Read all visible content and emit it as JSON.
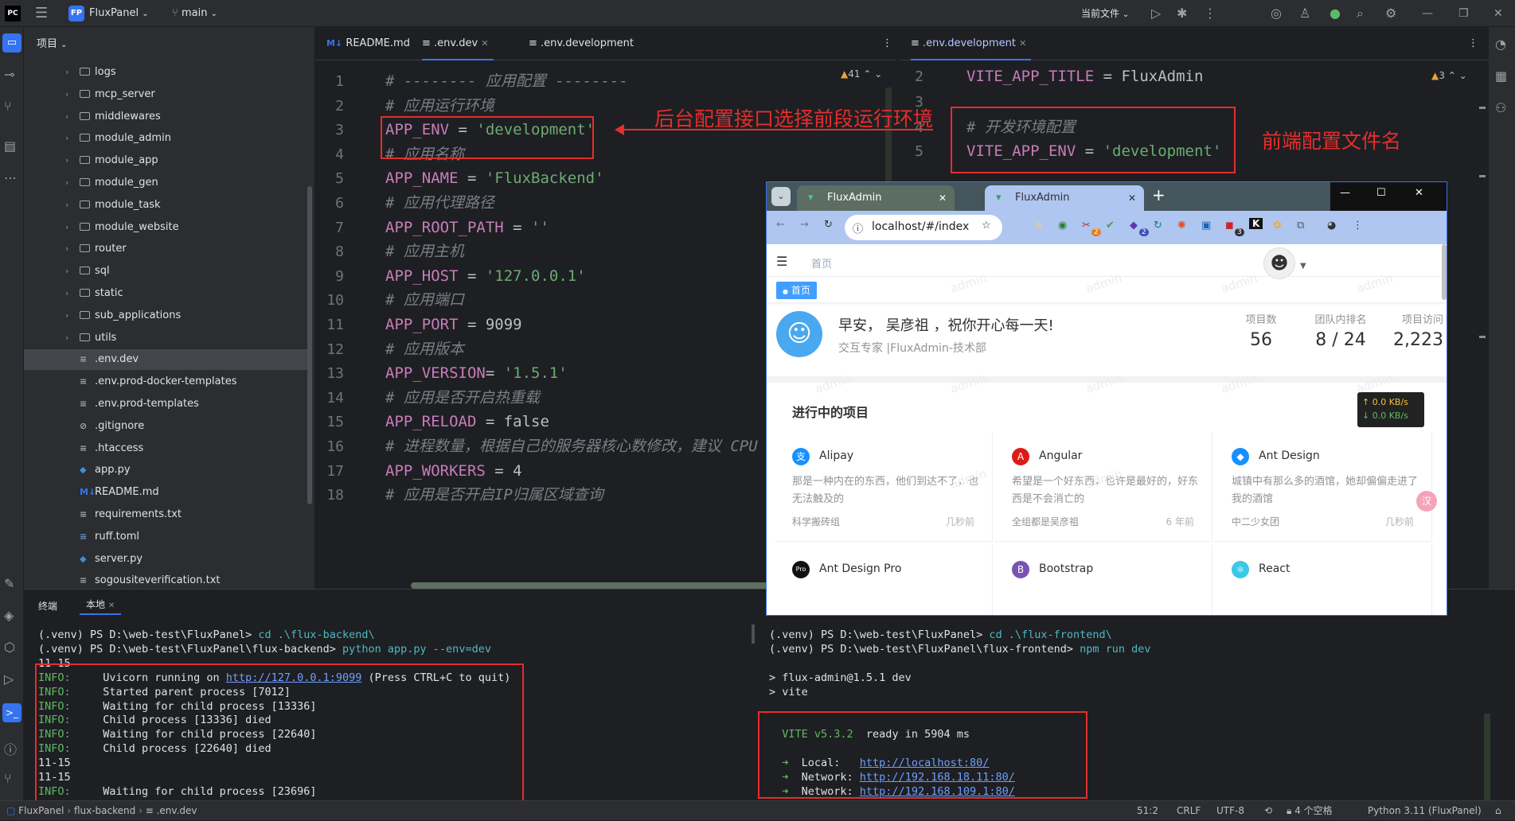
{
  "titlebar": {
    "project_badge": "FP",
    "project_name": "FluxPanel",
    "branch": "main",
    "run_config": "当前文件"
  },
  "project_panel": {
    "header": "项目",
    "items": [
      {
        "label": "logs",
        "type": "folder"
      },
      {
        "label": "mcp_server",
        "type": "folder"
      },
      {
        "label": "middlewares",
        "type": "folder"
      },
      {
        "label": "module_admin",
        "type": "folder"
      },
      {
        "label": "module_app",
        "type": "folder"
      },
      {
        "label": "module_gen",
        "type": "folder"
      },
      {
        "label": "module_task",
        "type": "folder"
      },
      {
        "label": "module_website",
        "type": "folder"
      },
      {
        "label": "router",
        "type": "folder"
      },
      {
        "label": "sql",
        "type": "folder"
      },
      {
        "label": "static",
        "type": "folder"
      },
      {
        "label": "sub_applications",
        "type": "folder"
      },
      {
        "label": "utils",
        "type": "folder"
      },
      {
        "label": ".env.dev",
        "type": "file"
      },
      {
        "label": ".env.prod-docker-templates",
        "type": "file"
      },
      {
        "label": ".env.prod-templates",
        "type": "file"
      },
      {
        "label": ".gitignore",
        "type": "file"
      },
      {
        "label": ".htaccess",
        "type": "file"
      },
      {
        "label": "app.py",
        "type": "file"
      },
      {
        "label": "README.md",
        "type": "file"
      },
      {
        "label": "requirements.txt",
        "type": "file"
      },
      {
        "label": "ruff.toml",
        "type": "file"
      },
      {
        "label": "server.py",
        "type": "file"
      },
      {
        "label": "sogousiteverification.txt",
        "type": "file"
      }
    ]
  },
  "editor_left": {
    "tabs": [
      "README.md",
      ".env.dev",
      ".env.development"
    ],
    "inspection_count": "41",
    "lines": [
      {
        "n": "1",
        "parts": [
          {
            "c": "cm",
            "t": "# -------- 应用配置 --------"
          }
        ]
      },
      {
        "n": "2",
        "parts": [
          {
            "c": "cm",
            "t": "# 应用运行环境"
          }
        ]
      },
      {
        "n": "3",
        "parts": [
          {
            "c": "ky",
            "t": "APP_ENV"
          },
          {
            "c": "val",
            "t": " = "
          },
          {
            "c": "st",
            "t": "'development'"
          }
        ]
      },
      {
        "n": "4",
        "parts": [
          {
            "c": "cm",
            "t": "# 应用名称"
          }
        ]
      },
      {
        "n": "5",
        "parts": [
          {
            "c": "ky",
            "t": "APP_NAME"
          },
          {
            "c": "val",
            "t": " = "
          },
          {
            "c": "st",
            "t": "'FluxBackend'"
          }
        ]
      },
      {
        "n": "6",
        "parts": [
          {
            "c": "cm",
            "t": "# 应用代理路径"
          }
        ]
      },
      {
        "n": "7",
        "parts": [
          {
            "c": "ky",
            "t": "APP_ROOT_PATH"
          },
          {
            "c": "val",
            "t": " = "
          },
          {
            "c": "st",
            "t": "''"
          }
        ]
      },
      {
        "n": "8",
        "parts": [
          {
            "c": "cm",
            "t": "# 应用主机"
          }
        ]
      },
      {
        "n": "9",
        "parts": [
          {
            "c": "ky",
            "t": "APP_HOST"
          },
          {
            "c": "val",
            "t": " = "
          },
          {
            "c": "st",
            "t": "'127.0.0.1'"
          }
        ]
      },
      {
        "n": "10",
        "parts": [
          {
            "c": "cm",
            "t": "# 应用端口"
          }
        ]
      },
      {
        "n": "11",
        "parts": [
          {
            "c": "ky",
            "t": "APP_PORT"
          },
          {
            "c": "val",
            "t": " = "
          },
          {
            "c": "val",
            "t": "9099"
          }
        ]
      },
      {
        "n": "12",
        "parts": [
          {
            "c": "cm",
            "t": "# 应用版本"
          }
        ]
      },
      {
        "n": "13",
        "parts": [
          {
            "c": "ky",
            "t": "APP_VERSION"
          },
          {
            "c": "val",
            "t": "= "
          },
          {
            "c": "st",
            "t": "'1.5.1'"
          }
        ]
      },
      {
        "n": "14",
        "parts": [
          {
            "c": "cm",
            "t": "# 应用是否开启热重载"
          }
        ]
      },
      {
        "n": "15",
        "parts": [
          {
            "c": "ky",
            "t": "APP_RELOAD"
          },
          {
            "c": "val",
            "t": " = "
          },
          {
            "c": "val",
            "t": "false"
          }
        ]
      },
      {
        "n": "16",
        "parts": [
          {
            "c": "cm",
            "t": "# 进程数量，根据自己的服务器核心数修改，建议 CPU"
          }
        ]
      },
      {
        "n": "17",
        "parts": [
          {
            "c": "ky",
            "t": "APP_WORKERS"
          },
          {
            "c": "val",
            "t": " = "
          },
          {
            "c": "val",
            "t": "4"
          }
        ]
      },
      {
        "n": "18",
        "parts": [
          {
            "c": "cm",
            "t": "# 应用是否开启IP归属区域查询"
          }
        ]
      }
    ]
  },
  "editor_right": {
    "tab": ".env.development",
    "inspection_count": "3",
    "lines": [
      {
        "n": "2",
        "parts": [
          {
            "c": "ky",
            "t": "VITE_APP_TITLE"
          },
          {
            "c": "val",
            "t": " = "
          },
          {
            "c": "val",
            "t": "FluxAdmin"
          }
        ]
      },
      {
        "n": "3",
        "parts": []
      },
      {
        "n": "4",
        "parts": [
          {
            "c": "cm",
            "t": "# 开发环境配置"
          }
        ]
      },
      {
        "n": "5",
        "parts": [
          {
            "c": "ky",
            "t": "VITE_APP_ENV"
          },
          {
            "c": "val",
            "t": " = "
          },
          {
            "c": "st",
            "t": "'development'"
          }
        ]
      }
    ]
  },
  "annotations": {
    "backend": "后台配置接口选择前段运行环境",
    "frontend": "前端配置文件名"
  },
  "browser": {
    "tabs": [
      "FluxAdmin",
      "FluxAdmin"
    ],
    "url": "localhost/#/index",
    "ext_badges": [
      "2",
      "2",
      "3"
    ],
    "breadcrumb": "首页",
    "tag": "首页",
    "greeting": "早安， 吴彦祖 ，祝你开心每一天!",
    "subtitle": "交互专家 |FluxAdmin-技术部",
    "stats": [
      {
        "label": "项目数",
        "value": "56"
      },
      {
        "label": "团队内排名",
        "value": "8 / 24"
      },
      {
        "label": "项目访问",
        "value": "2,223"
      }
    ],
    "section_title": "进行中的项目",
    "net_speed_up": "↑ 0.0 KB/s",
    "net_speed_down": "↓ 0.0 KB/s",
    "watermark": "admin",
    "projects": [
      {
        "title": "Alipay",
        "desc": "那是一种内在的东西，他们到达不了，也无法触及的",
        "group": "科学搬砖组",
        "time": "几秒前",
        "color": "#1890ff",
        "glyph": "支"
      },
      {
        "title": "Angular",
        "desc": "希望是一个好东西，也许是最好的，好东西是不会消亡的",
        "group": "全组都是吴彦祖",
        "time": "6 年前",
        "color": "#dd1b16",
        "glyph": "A"
      },
      {
        "title": "Ant Design",
        "desc": "城镇中有那么多的酒馆，她却偏偏走进了我的酒馆",
        "group": "中二少女团",
        "time": "几秒前",
        "color": "#1890ff",
        "glyph": "◆"
      },
      {
        "title": "Ant Design Pro",
        "desc": "",
        "group": "",
        "time": "",
        "color": "#111111",
        "glyph": "Pro"
      },
      {
        "title": "Bootstrap",
        "desc": "",
        "group": "",
        "time": "",
        "color": "#7952b3",
        "glyph": "B"
      },
      {
        "title": "React",
        "desc": "",
        "group": "",
        "time": "",
        "color": "#3cc8e6",
        "glyph": "⚛"
      }
    ]
  },
  "terminal": {
    "tabs": [
      "终端",
      "本地"
    ],
    "left_lines": [
      [
        {
          "c": "",
          "t": "(.venv) PS D:\\web-test\\FluxPanel> "
        },
        {
          "c": "cyan",
          "t": "cd .\\flux-backend\\"
        }
      ],
      [
        {
          "c": "",
          "t": "(.venv) PS D:\\web-test\\FluxPanel\\flux-backend> "
        },
        {
          "c": "cyan",
          "t": "python app.py --env=dev"
        }
      ],
      [
        {
          "c": "",
          "t": "11-15"
        }
      ],
      [
        {
          "c": "green",
          "t": "INFO:"
        },
        {
          "c": "",
          "t": "     Uvicorn running on "
        },
        {
          "c": "link",
          "t": "http://127.0.0.1:9099"
        },
        {
          "c": "",
          "t": " (Press CTRL+C to quit)"
        }
      ],
      [
        {
          "c": "green",
          "t": "INFO:"
        },
        {
          "c": "",
          "t": "     Started parent process [7012]"
        }
      ],
      [
        {
          "c": "green",
          "t": "INFO:"
        },
        {
          "c": "",
          "t": "     Waiting for child process [13336]"
        }
      ],
      [
        {
          "c": "green",
          "t": "INFO:"
        },
        {
          "c": "",
          "t": "     Child process [13336] died"
        }
      ],
      [
        {
          "c": "green",
          "t": "INFO:"
        },
        {
          "c": "",
          "t": "     Waiting for child process [22640]"
        }
      ],
      [
        {
          "c": "green",
          "t": "INFO:"
        },
        {
          "c": "",
          "t": "     Child process [22640] died"
        }
      ],
      [
        {
          "c": "",
          "t": "11-15"
        }
      ],
      [
        {
          "c": "",
          "t": "11-15"
        }
      ],
      [
        {
          "c": "green",
          "t": "INFO:"
        },
        {
          "c": "",
          "t": "     Waiting for child process [23696]"
        }
      ]
    ],
    "right_lines": [
      [
        {
          "c": "",
          "t": "(.venv) PS D:\\web-test\\FluxPanel> "
        },
        {
          "c": "cyan",
          "t": "cd .\\flux-frontend\\"
        }
      ],
      [
        {
          "c": "",
          "t": "(.venv) PS D:\\web-test\\FluxPanel\\flux-frontend> "
        },
        {
          "c": "cyan",
          "t": "npm run dev"
        }
      ],
      [
        {
          "c": "",
          "t": ""
        }
      ],
      [
        {
          "c": "",
          "t": "> flux-admin@1.5.1 dev"
        }
      ],
      [
        {
          "c": "",
          "t": "> vite"
        }
      ],
      [
        {
          "c": "",
          "t": ""
        }
      ],
      [
        {
          "c": "",
          "t": ""
        }
      ],
      [
        {
          "c": "green",
          "t": "  VITE v5.3.2"
        },
        {
          "c": "",
          "t": "  ready in "
        },
        {
          "c": "",
          "t": "5904"
        },
        {
          "c": "",
          "t": " ms"
        }
      ],
      [
        {
          "c": "",
          "t": ""
        }
      ],
      [
        {
          "c": "green",
          "t": "  ➜"
        },
        {
          "c": "",
          "t": "  Local:   "
        },
        {
          "c": "link",
          "t": "http://localhost:80/"
        }
      ],
      [
        {
          "c": "green",
          "t": "  ➜"
        },
        {
          "c": "",
          "t": "  Network: "
        },
        {
          "c": "link",
          "t": "http://192.168.18.11:80/"
        }
      ],
      [
        {
          "c": "green",
          "t": "  ➜"
        },
        {
          "c": "",
          "t": "  Network: "
        },
        {
          "c": "link",
          "t": "http://192.168.109.1:80/"
        }
      ]
    ]
  },
  "statusbar": {
    "crumbs": [
      "FluxPanel",
      "flux-backend",
      ".env.dev"
    ],
    "position": "51:2",
    "line_sep": "CRLF",
    "encoding": "UTF-8",
    "indent": "4 个空格",
    "interpreter": "Python 3.11 (FluxPanel)"
  },
  "colors": {
    "accent": "#3574f0",
    "annotation": "#e52d2d"
  }
}
